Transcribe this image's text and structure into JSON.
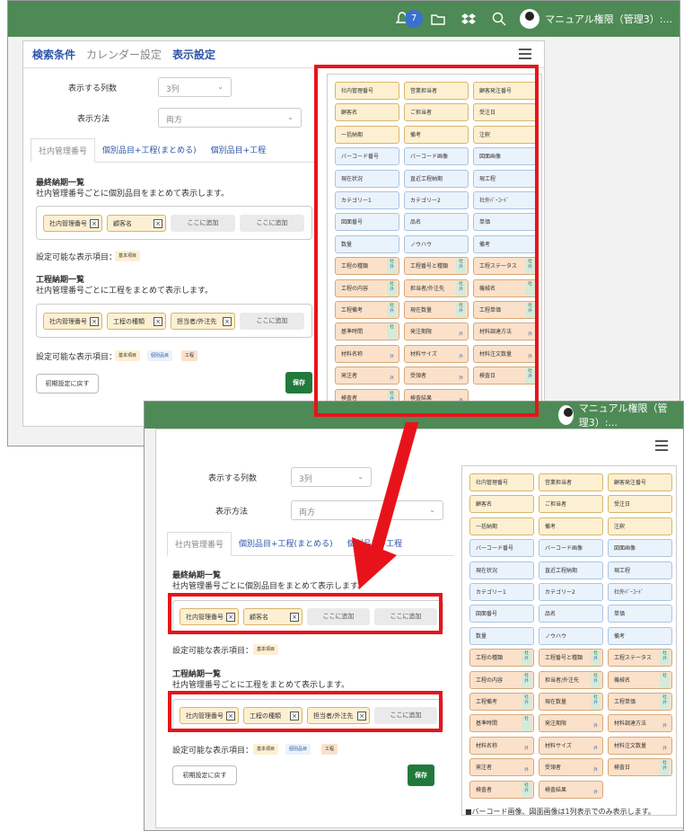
{
  "topbar": {
    "notifications": "7",
    "user_label": "マニュアル権限（管理3）:..."
  },
  "tabs": {
    "search": "検索条件",
    "calendar": "カレンダー設定",
    "display": "表示設定"
  },
  "form": {
    "columns_label": "表示する列数",
    "columns_value": "3列",
    "method_label": "表示方法",
    "method_value": "両方"
  },
  "subtabs": [
    "社内管理番号",
    "個別品目+工程(まとめる)",
    "個別品目+工程"
  ],
  "final": {
    "title": "最終納期一覧",
    "desc": "社内管理番号ごとに個別品目をまとめて表示します。",
    "slots": [
      "社内管理番号",
      "顧客名",
      "ここに追加",
      "ここに追加"
    ],
    "avail_label": "設定可能な表示項目：",
    "avail_chips": [
      "基本項目"
    ]
  },
  "process": {
    "title": "工程納期一覧",
    "desc": "社内管理番号ごとに工程をまとめて表示します。",
    "slots": [
      "社内管理番号",
      "工程の種類",
      "担当者/外注先",
      "ここに追加"
    ],
    "avail_label": "設定可能な表示項目：",
    "avail_chips": [
      "基本項目",
      "個別品目",
      "工程"
    ]
  },
  "buttons": {
    "reset": "初期設定に戻す",
    "save": "保存"
  },
  "items": [
    {
      "t": "社内管理番号",
      "c": "y"
    },
    {
      "t": "営業担当者",
      "c": "y"
    },
    {
      "t": "顧客発注番号",
      "c": "y"
    },
    {
      "t": "顧客名",
      "c": "y"
    },
    {
      "t": "ご担当者",
      "c": "y"
    },
    {
      "t": "受注日",
      "c": "y"
    },
    {
      "t": "一括納期",
      "c": "y"
    },
    {
      "t": "備考",
      "c": "y"
    },
    {
      "t": "注釈",
      "c": "y"
    },
    {
      "t": "バーコード番号",
      "c": "b"
    },
    {
      "t": "バーコード画像",
      "c": "b"
    },
    {
      "t": "図面画像",
      "c": "b"
    },
    {
      "t": "現在状況",
      "c": "b"
    },
    {
      "t": "直近工程納期",
      "c": "b"
    },
    {
      "t": "現工程",
      "c": "b"
    },
    {
      "t": "カテゴリー1",
      "c": "b"
    },
    {
      "t": "カテゴリー2",
      "c": "b"
    },
    {
      "t": "社外ﾊﾞｰｺｰﾄﾞ",
      "c": "b"
    },
    {
      "t": "図面番号",
      "c": "b"
    },
    {
      "t": "品名",
      "c": "b"
    },
    {
      "t": "単価",
      "c": "b"
    },
    {
      "t": "数量",
      "c": "b"
    },
    {
      "t": "ノウハウ",
      "c": "b"
    },
    {
      "t": "備考",
      "c": "b"
    },
    {
      "t": "工程の種類",
      "c": "o",
      "k": "kg"
    },
    {
      "t": "工程番号と種類",
      "c": "o",
      "k": "kg"
    },
    {
      "t": "工程ステータス",
      "c": "o",
      "k": "kg"
    },
    {
      "t": "工程の内容",
      "c": "o",
      "k": "kg"
    },
    {
      "t": "担当者/外注先",
      "c": "o",
      "k": "kg"
    },
    {
      "t": "機械名",
      "c": "o",
      "k": "k"
    },
    {
      "t": "工程備考",
      "c": "o",
      "k": "kg"
    },
    {
      "t": "現在数量",
      "c": "o",
      "k": "kg"
    },
    {
      "t": "工程単価",
      "c": "o",
      "k": "kg"
    },
    {
      "t": "基準時間",
      "c": "o",
      "k": "k"
    },
    {
      "t": "発注期限",
      "c": "o",
      "k": "g"
    },
    {
      "t": "材料調達方法",
      "c": "o",
      "k": "g"
    },
    {
      "t": "材料名称",
      "c": "o",
      "k": "g"
    },
    {
      "t": "材料サイズ",
      "c": "o",
      "k": "g"
    },
    {
      "t": "材料注文数量",
      "c": "o",
      "k": "g"
    },
    {
      "t": "発注者",
      "c": "o",
      "k": "g"
    },
    {
      "t": "受領者",
      "c": "o",
      "k": "g"
    },
    {
      "t": "検査日",
      "c": "o",
      "k": "kg"
    },
    {
      "t": "検査者",
      "c": "o",
      "k": "kg"
    },
    {
      "t": "検査結果",
      "c": "o",
      "k": "g"
    }
  ],
  "kg_label": {
    "top": "社",
    "bottom": "外"
  },
  "note": "■バーコード画像、図面画像は1列表示でのみ表示します。",
  "colors": {
    "highlight": "#e8131a",
    "header": "#4e8a55",
    "save": "#217a3c"
  }
}
